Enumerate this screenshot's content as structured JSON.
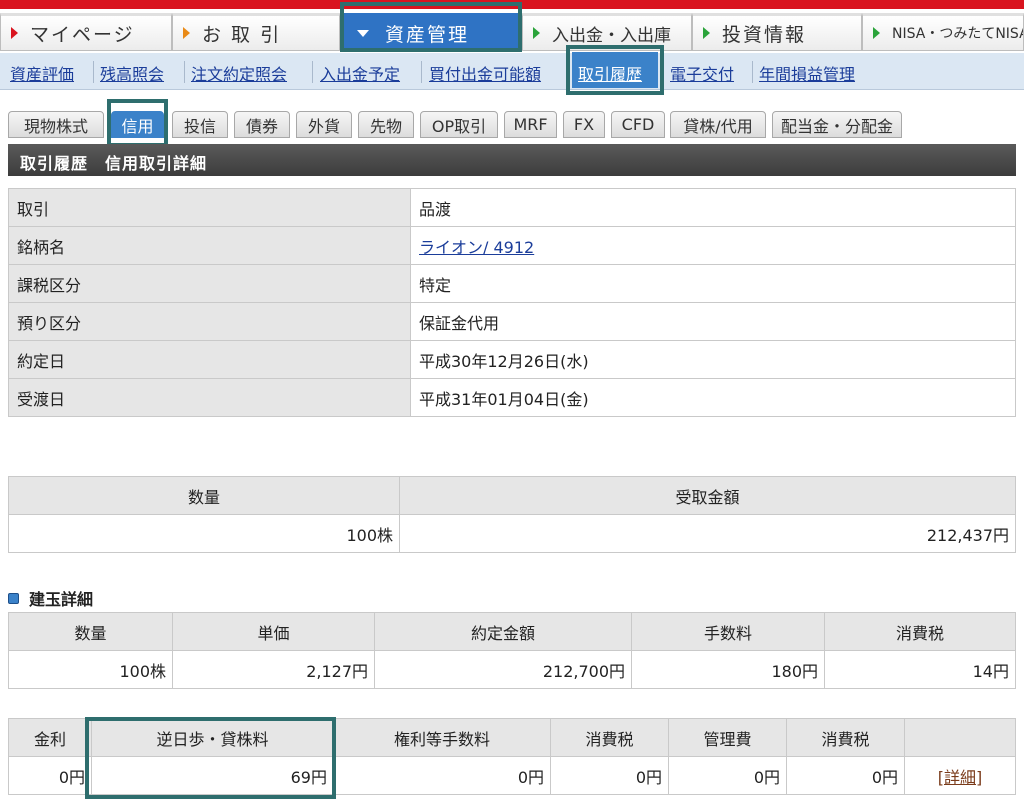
{
  "main_nav": [
    {
      "label": "マイページ",
      "arrow": "red"
    },
    {
      "label": "お 取 引",
      "arrow": "orange"
    },
    {
      "label": "資産管理",
      "arrow": "down",
      "active": true
    },
    {
      "label": "入出金・入出庫",
      "arrow": "green"
    },
    {
      "label": "投資情報",
      "arrow": "green"
    },
    {
      "label": "NISA・つみたてNISA",
      "arrow": "green"
    }
  ],
  "sub_nav": [
    "資産評価",
    "残高照会",
    "注文約定照会",
    "入出金予定",
    "買付出金可能額",
    "取引履歴",
    "電子交付",
    "年間損益管理"
  ],
  "sub_nav_active": "取引履歴",
  "category_tabs": [
    "現物株式",
    "信用",
    "投信",
    "債券",
    "外貨",
    "先物",
    "OP取引",
    "MRF",
    "FX",
    "CFD",
    "貸株/代用",
    "配当金・分配金"
  ],
  "category_active": "信用",
  "title_bar": "取引履歴　信用取引詳細",
  "detail": [
    {
      "label": "取引",
      "value": "品渡"
    },
    {
      "label": "銘柄名",
      "value": "ライオン/ 4912"
    },
    {
      "label": "課税区分",
      "value": "特定"
    },
    {
      "label": "預り区分",
      "value": "保証金代用"
    },
    {
      "label": "約定日",
      "value": "平成30年12月26日(水)"
    },
    {
      "label": "受渡日",
      "value": "平成31年01月04日(金)"
    }
  ],
  "summary": {
    "headers": [
      "数量",
      "受取金額"
    ],
    "values": [
      "100株",
      "212,437円"
    ]
  },
  "section_title": "建玉詳細",
  "position": {
    "headers": [
      "数量",
      "単価",
      "約定金額",
      "手数料",
      "消費税"
    ],
    "values": [
      "100株",
      "2,127円",
      "212,700円",
      "180円",
      "14円"
    ]
  },
  "fees": {
    "headers": [
      "金利",
      "逆日歩・貸株料",
      "権利等手数料",
      "消費税",
      "管理費",
      "消費税",
      ""
    ],
    "values": [
      "0円",
      "69円",
      "0円",
      "0円",
      "0円",
      "0円"
    ],
    "detail_link": "[詳細]"
  }
}
